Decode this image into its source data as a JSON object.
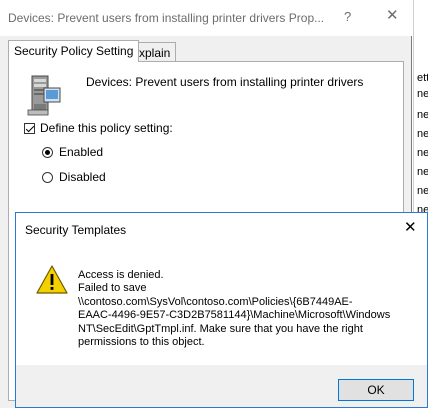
{
  "background_window": {
    "rows": [
      "ett",
      "ne",
      "ne",
      "ne",
      "ne",
      "ne",
      "ne",
      "ne",
      "ne",
      "ne",
      "ne",
      "ne",
      "ne",
      "ne"
    ]
  },
  "properties_dialog": {
    "title": "Devices: Prevent users from installing printer drivers Prop...",
    "help_glyph": "?",
    "close_glyph": "✕",
    "tabs": [
      {
        "label": "Security Policy Setting",
        "active": true
      },
      {
        "label": "Explain",
        "active": false
      }
    ],
    "policy_name": "Devices: Prevent users from installing printer drivers",
    "define_label": "Define this policy setting:",
    "define_checked": true,
    "options": [
      {
        "label": "Enabled",
        "selected": true
      },
      {
        "label": "Disabled",
        "selected": false
      }
    ],
    "policy_icon": "server-computer-icon"
  },
  "error_dialog": {
    "title": "Security Templates",
    "close_glyph": "✕",
    "icon": "warning-icon",
    "message_lines": [
      "Access is denied.",
      "Failed to save",
      "\\\\contoso.com\\SysVol\\contoso.com\\Policies\\{6B7449AE-",
      "EAAC-4496-9E57-C3D2B7581144}\\Machine\\Microsoft\\Windows",
      "NT\\SecEdit\\GptTmpl.inf. Make sure that you have the right",
      "permissions to this object."
    ],
    "ok_label": "OK"
  },
  "colors": {
    "dialog_border": "#2b79d0",
    "warning_yellow": "#f5d000",
    "button_focus": "#0078d7"
  }
}
